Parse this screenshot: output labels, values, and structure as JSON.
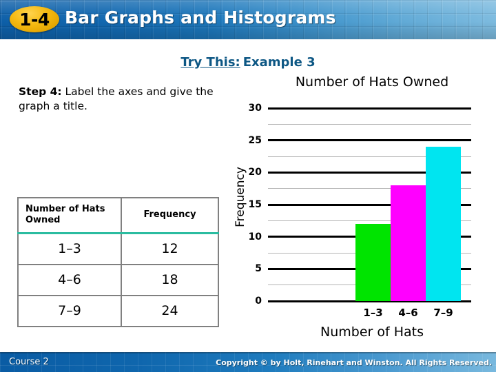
{
  "header": {
    "badge": "1-4",
    "title": "Bar Graphs and Histograms"
  },
  "content": {
    "try_this_label": "Try This:",
    "example_label": "Example 3",
    "step_prefix": "Step 4:",
    "step_body": "Label the axes and give the graph a title."
  },
  "table": {
    "headers": [
      "Number of Hats Owned",
      "Frequency"
    ],
    "rows": [
      {
        "interval": "1–3",
        "frequency": "12"
      },
      {
        "interval": "4–6",
        "frequency": "18"
      },
      {
        "interval": "7–9",
        "frequency": "24"
      }
    ],
    "accent_color": "#2bbca0",
    "border_color": "#808080"
  },
  "chart_data": {
    "type": "bar",
    "title": "Number of Hats Owned",
    "xlabel": "Number of Hats",
    "ylabel": "Frequency",
    "categories": [
      "1–3",
      "4–6",
      "7–9"
    ],
    "values": [
      12,
      18,
      24
    ],
    "colors": [
      "#00e400",
      "#ff00ff",
      "#00e5f0"
    ],
    "ylim": [
      0,
      30
    ],
    "ytick_values": [
      30,
      25,
      20,
      15,
      10,
      5,
      0
    ],
    "ytick_labels": [
      "30",
      "25",
      "20",
      "15",
      "10",
      "5",
      "0"
    ],
    "minor_tick_values": [
      27.5,
      22.5,
      17.5,
      12.5,
      7.5,
      2.5
    ],
    "grid": true,
    "grid_major_color": "#000000",
    "grid_minor_color": "#b3b3b3",
    "legend": null
  },
  "footer": {
    "course": "Course 2",
    "copyright": "Copyright © by Holt, Rinehart and Winston. All Rights Reserved."
  }
}
